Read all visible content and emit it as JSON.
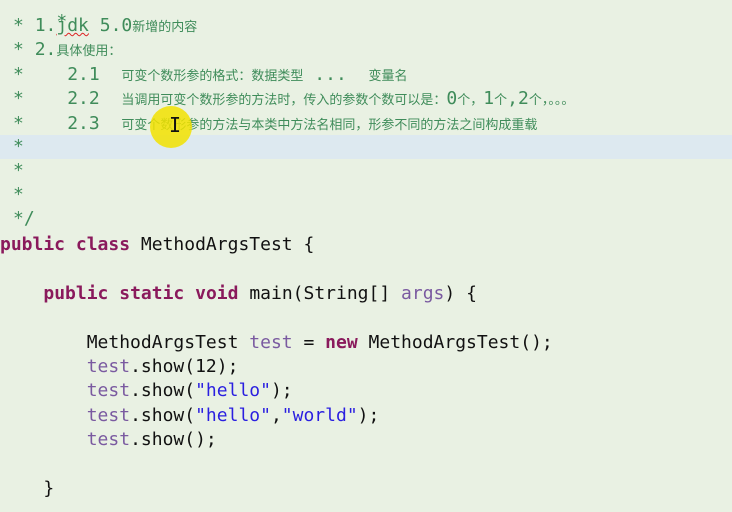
{
  "comment": {
    "star": "*",
    "close": "*/",
    "l1_num": "1.",
    "l1_jdk": "jdk",
    "l1_ver": " 5.0",
    "l1_text": "新增的内容",
    "l2_num": "2.",
    "l2_text": "具体使用：",
    "l3_num": "2.1",
    "l3_text": "可变个数形参的格式：数据类型",
    "l3_dots": "...",
    "l3_tail": "变量名",
    "l4_num": "2.2",
    "l4_text": "当调用可变个数形参的方法时，传入的参数个数可以是：",
    "l4_a": "0",
    "l4_b": "个，",
    "l4_c": "1",
    "l4_d": "个",
    "l4_e": ",2",
    "l4_f": "个，。。。",
    "l5_num": "2.3",
    "l5_text": "可变个数形参的方法与本类中方法名相同，形参不同的方法之间构成重载"
  },
  "code": {
    "kw_public": "public",
    "kw_class": "class",
    "class_name": "MethodArgsTest",
    "brace_open": "{",
    "brace_close": "}",
    "kw_static": "static",
    "kw_void": "void",
    "main_sig": "main(String[]",
    "main_param": "args",
    "main_end": ") {",
    "decl_type": "MethodArgsTest",
    "decl_var": "test",
    "decl_eq": "=",
    "kw_new": "new",
    "decl_ctor": "MethodArgsTest();",
    "call_obj": "test",
    "call1": ".show(12);",
    "call2_a": ".show(",
    "call2_str": "\"hello\"",
    "call2_b": ");",
    "call3_a": ".show(",
    "call3_s1": "\"hello\"",
    "call3_comma": ",",
    "call3_s2": "\"world\"",
    "call3_b": ");",
    "call4": ".show();"
  },
  "colors": {
    "background": "#e9f1e3",
    "current_line": "#dde9f0",
    "comment": "#3f8c5a",
    "keyword": "#8a1a5c",
    "string": "#2a1fe0",
    "variable": "#7a5aa0",
    "cursor_highlight": "#f2e200"
  },
  "icons": {
    "cursor": "text-cursor-ibeam"
  },
  "cursor_glyph": "I"
}
